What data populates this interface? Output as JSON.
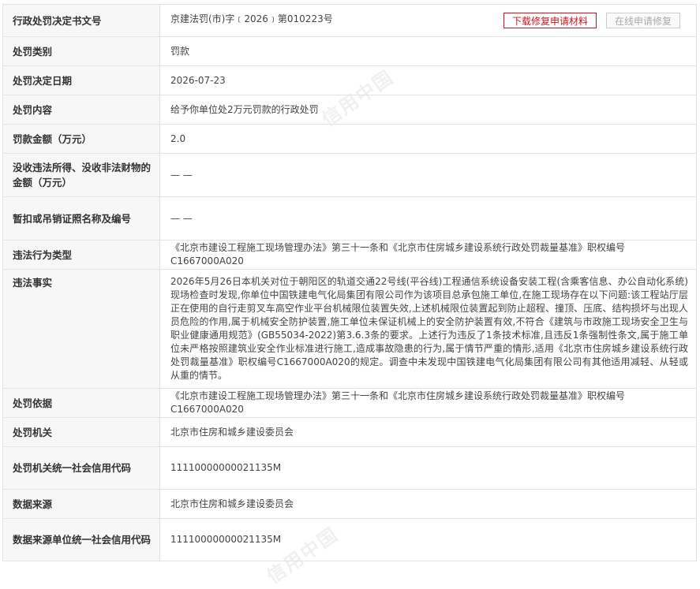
{
  "colors": {
    "label_bg": "#f7f7f7",
    "border": "#e4e4e4",
    "accent_red": "#c7161e",
    "disabled_gray": "#aaaaaa"
  },
  "watermark": "信用中国",
  "rows": [
    {
      "label": "行政处罚决定书文号",
      "value": "京建法罚(市)字﹝2026﹞第010223号"
    },
    {
      "label": "处罚类别",
      "value": "罚款"
    },
    {
      "label": "处罚决定日期",
      "value": "2026-07-23"
    },
    {
      "label": "处罚内容",
      "value": "给予你单位处2万元罚款的行政处罚"
    },
    {
      "label": "罚款金额（万元）",
      "value": "2.0"
    },
    {
      "label": "没收违法所得、没收非法财物的金额（万元）",
      "value": "— —"
    },
    {
      "label": "暂扣或吊销证照名称及编号",
      "value": "— —"
    },
    {
      "label": "违法行为类型",
      "value": "《北京市建设工程施工现场管理办法》第三十一条和《北京市住房城乡建设系统行政处罚裁量基准》职权编号C1667000A020"
    },
    {
      "label": "违法事实",
      "value": "2026年5月26日本机关对位于朝阳区的轨道交通22号线(平谷线)工程通信系统设备安装工程(含乘客信息、办公自动化系统)现场检查时发现,你单位中国铁建电气化局集团有限公司作为该项目总承包施工单位,在施工现场存在以下问题:该工程站厅层正在使用的自行走剪叉车高空作业平台机械限位装置失效,上述机械限位装置起到防止超程、撞顶、压底、结构损坏与出现人员危险的作用,属于机械安全防护装置,施工单位未保证机械上的安全防护装置有效,不符合《建筑与市政施工现场安全卫生与职业健康通用规范》(GB55034-2022)第3.6.3条的要求。上述行为违反了1条技术标准,且违反1条强制性条文,属于施工单位未严格按照建筑业安全作业标准进行施工,造成事故隐患的行为,属于情节严重的情形,适用《北京市住房城乡建设系统行政处罚裁量基准》职权编号C1667000A020的规定。调查中未发现中国铁建电气化局集团有限公司有其他适用减轻、从轻或从重的情节。"
    },
    {
      "label": "处罚依据",
      "value": "《北京市建设工程施工现场管理办法》第三十一条和《北京市住房城乡建设系统行政处罚裁量基准》职权编号C1667000A020"
    },
    {
      "label": "处罚机关",
      "value": "北京市住房和城乡建设委员会"
    },
    {
      "label": "处罚机关统一社会信用代码",
      "value": "11110000000021135M"
    },
    {
      "label": "数据来源",
      "value": "北京市住房和城乡建设委员会"
    },
    {
      "label": "数据来源单位统一社会信用代码",
      "value": "11110000000021135M"
    }
  ],
  "buttons": {
    "download": "下载修复申请材料",
    "apply": "在线申请修复"
  }
}
